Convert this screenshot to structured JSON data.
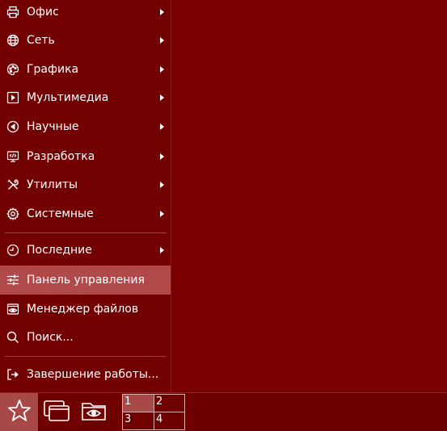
{
  "menu": {
    "items": [
      {
        "label": "Офис",
        "icon": "printer-icon",
        "submenu": true
      },
      {
        "label": "Сеть",
        "icon": "globe-icon",
        "submenu": true
      },
      {
        "label": "Графика",
        "icon": "palette-icon",
        "submenu": true
      },
      {
        "label": "Мультимедиа",
        "icon": "play-icon",
        "submenu": true
      },
      {
        "label": "Научные",
        "icon": "science-icon",
        "submenu": true
      },
      {
        "label": "Разработка",
        "icon": "code-monitor-icon",
        "submenu": true
      },
      {
        "label": "Утилиты",
        "icon": "tools-icon",
        "submenu": true
      },
      {
        "label": "Системные",
        "icon": "gear-icon",
        "submenu": true
      },
      {
        "label": "Последние",
        "icon": "clock-icon",
        "submenu": true
      },
      {
        "label": "Панель управления",
        "icon": "sliders-icon",
        "submenu": false,
        "active": true
      },
      {
        "label": "Менеджер файлов",
        "icon": "file-manager-icon",
        "submenu": false
      },
      {
        "label": "Поиск...",
        "icon": "search-icon",
        "submenu": false
      },
      {
        "label": "Завершение работы...",
        "icon": "logout-icon",
        "submenu": false
      }
    ]
  },
  "taskbar": {
    "start_icon": "star-icon",
    "buttons": [
      {
        "icon": "windows-icon"
      },
      {
        "icon": "folder-eye-icon"
      }
    ],
    "pager": {
      "workspaces": [
        "1",
        "2",
        "3",
        "4"
      ],
      "active": "1"
    }
  },
  "colors": {
    "desktop": "#780000",
    "menu": "#720000",
    "highlight": "#b04a4a",
    "text": "#ffffff"
  }
}
